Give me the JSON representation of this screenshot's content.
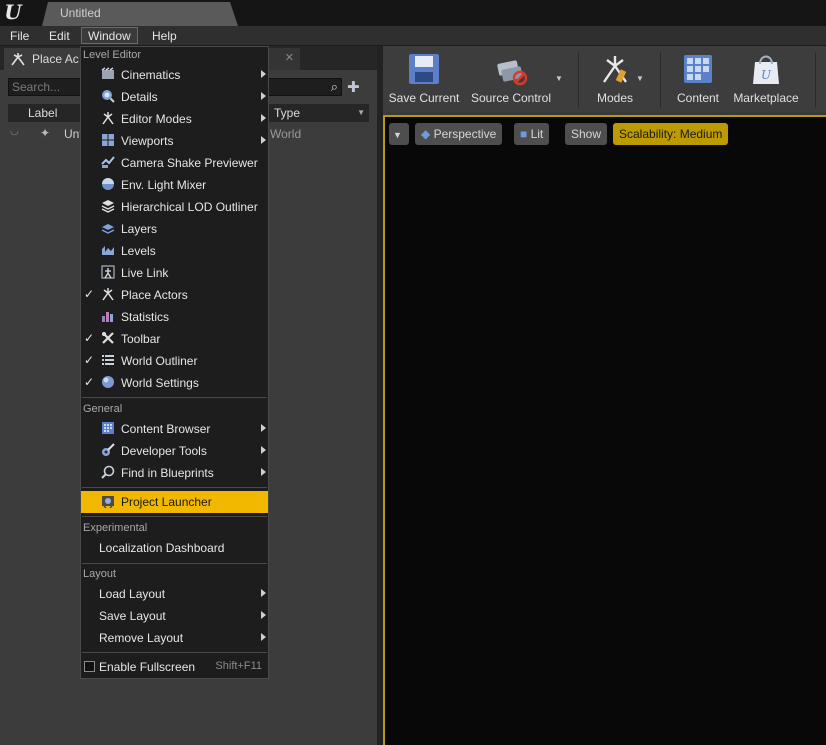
{
  "titlebar": {
    "doc_tab": "Untitled"
  },
  "menubar": {
    "file": "File",
    "edit": "Edit",
    "window": "Window",
    "help": "Help"
  },
  "left_panel": {
    "tab_label": "Place Ac",
    "search_placeholder": "Search...",
    "col_label": "Label",
    "col_type": "Type",
    "row_name": "Unt",
    "row_type": "World"
  },
  "toolbar": {
    "save": "Save Current",
    "source": "Source Control",
    "modes": "Modes",
    "content": "Content",
    "marketplace": "Marketplace"
  },
  "viewport": {
    "perspective": "Perspective",
    "lit": "Lit",
    "show": "Show",
    "scalability": "Scalability: Medium"
  },
  "menu": {
    "sections": {
      "level_editor": "Level Editor",
      "general": "General",
      "experimental": "Experimental",
      "layout": "Layout"
    },
    "level_editor_items": [
      {
        "label": "Cinematics"
      },
      {
        "label": "Details"
      },
      {
        "label": "Editor Modes"
      },
      {
        "label": "Viewports"
      },
      {
        "label": "Camera Shake Previewer"
      },
      {
        "label": "Env. Light Mixer"
      },
      {
        "label": "Hierarchical LOD Outliner"
      },
      {
        "label": "Layers"
      },
      {
        "label": "Levels"
      },
      {
        "label": "Live Link"
      },
      {
        "label": "Place Actors"
      },
      {
        "label": "Statistics"
      },
      {
        "label": "Toolbar"
      },
      {
        "label": "World Outliner"
      },
      {
        "label": "World Settings"
      }
    ],
    "general_items": [
      {
        "label": "Content Browser"
      },
      {
        "label": "Developer Tools"
      },
      {
        "label": "Find in Blueprints"
      },
      {
        "label": "Project Launcher"
      }
    ],
    "experimental_items": [
      {
        "label": "Localization Dashboard"
      }
    ],
    "layout_items": [
      {
        "label": "Load Layout"
      },
      {
        "label": "Save Layout"
      },
      {
        "label": "Remove Layout"
      },
      {
        "label": "Enable Fullscreen",
        "shortcut": "Shift+F11"
      }
    ],
    "check_mark": "✓",
    "colors": {
      "highlight": "#f2b800",
      "background": "#1d1d1d"
    }
  }
}
